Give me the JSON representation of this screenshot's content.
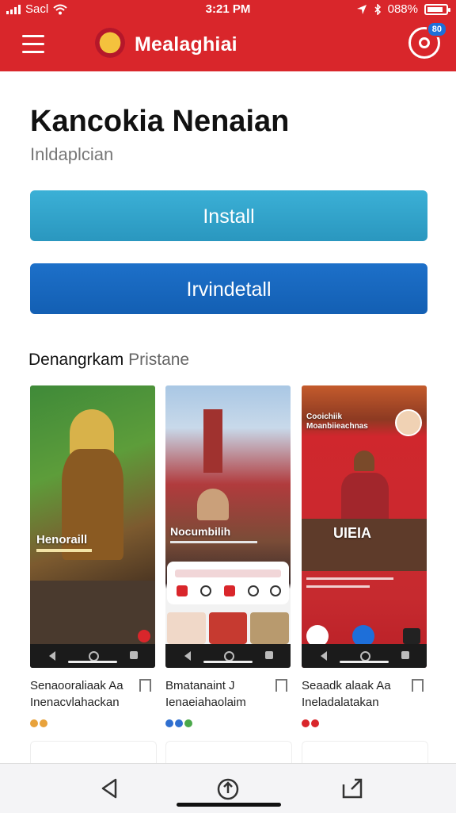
{
  "status_bar": {
    "carrier": "Sacl",
    "time": "3:21 PM",
    "battery": "088%",
    "battery_level": 0.88
  },
  "header": {
    "brand": "Mealaghiai",
    "notification_count": "80",
    "colors": {
      "background": "#d9262b",
      "badge": "#1e6fd9"
    }
  },
  "app": {
    "title": "Kancokia Nenaian",
    "developer": "Inldaplcian",
    "install_label": "Install",
    "uninstall_label": "Irvindetall",
    "colors": {
      "install": "#2a97bf",
      "uninstall": "#135fb3"
    }
  },
  "screenshots_section": {
    "title_main": "Denangrkam",
    "title_accent": "Pristane"
  },
  "screenshots": [
    {
      "overlay": "Henoraill",
      "title": "Senaooraliaak Aa",
      "subtitle": "Inenacvlahackan",
      "dot_colors": [
        "#e8a23b",
        "#e8a23b"
      ]
    },
    {
      "overlay": "Nocumbilih",
      "title": "Bmatanaint J",
      "subtitle": "Ienaeiahaolaim",
      "dot_colors": [
        "#2f6fd0",
        "#2f6fd0",
        "#4aa84a"
      ]
    },
    {
      "overlay": "UIEIA",
      "top_heading": "Cooichiik Moanbiieachnas",
      "title": "Seaadk alaak Aa",
      "subtitle": "Ineladalatakan",
      "dot_colors": [
        "#d9262b",
        "#d9262b"
      ]
    }
  ],
  "bottom_nav": {
    "items": [
      "back-icon",
      "share-icon",
      "open-external-icon"
    ]
  }
}
